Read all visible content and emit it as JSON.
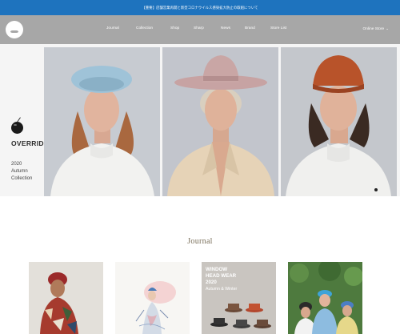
{
  "announcement": {
    "text": "【重要】店舗営業再開と新型コロナウイルス感染拡大防止の取組について"
  },
  "nav": {
    "items": [
      {
        "label": "Journal"
      },
      {
        "label": "Collection"
      },
      {
        "label": "Shop"
      },
      {
        "label": "Sharp"
      },
      {
        "label": "News"
      },
      {
        "label": "Brand"
      },
      {
        "label": "Store List"
      }
    ],
    "online_store_label": "Online Store"
  },
  "hero": {
    "brand": "OVERRIDE",
    "season_line1": "2020",
    "season_line2": "Autumn",
    "season_line3": "Collection",
    "slide_count": 1
  },
  "journal": {
    "title": "Journal",
    "cards": [
      {
        "image": "man-red-beret-photo"
      },
      {
        "image": "fashion-illustration"
      },
      {
        "image": "hats-display-poster",
        "poster_line1": "WINDOW",
        "poster_line2": "HEAD WEAR",
        "poster_line3": "2020",
        "poster_line4": "Autumn & Winter"
      },
      {
        "image": "people-in-caps-photo"
      }
    ]
  },
  "colors": {
    "announcement_bg": "#1e73be",
    "nav_bg": "#a7a7a7",
    "hero_bg": "#f5f5f5",
    "journal_title": "#7a6f5a"
  }
}
